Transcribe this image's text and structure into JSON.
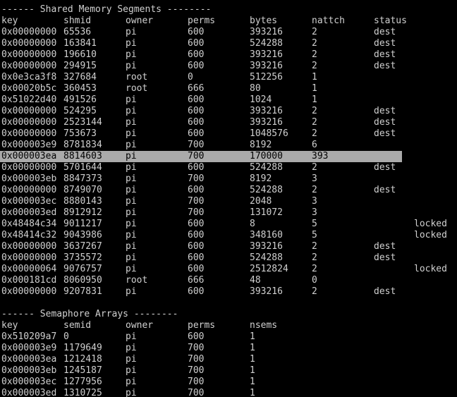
{
  "shm": {
    "title": "------ Shared Memory Segments --------",
    "headers": [
      "key",
      "shmid",
      "owner",
      "perms",
      "bytes",
      "nattch",
      "status"
    ],
    "rows": [
      [
        "0x00000000",
        "65536",
        "pi",
        "600",
        "393216",
        "2",
        "dest",
        ""
      ],
      [
        "0x00000000",
        "163841",
        "pi",
        "600",
        "524288",
        "2",
        "dest",
        ""
      ],
      [
        "0x00000000",
        "196610",
        "pi",
        "600",
        "393216",
        "2",
        "dest",
        ""
      ],
      [
        "0x00000000",
        "294915",
        "pi",
        "600",
        "393216",
        "2",
        "dest",
        ""
      ],
      [
        "0x0e3ca3f8",
        "327684",
        "root",
        "0",
        "512256",
        "1",
        "",
        ""
      ],
      [
        "0x00020b5c",
        "360453",
        "root",
        "666",
        "80",
        "1",
        "",
        ""
      ],
      [
        "0x51022d40",
        "491526",
        "pi",
        "600",
        "1024",
        "1",
        "",
        ""
      ],
      [
        "0x00000000",
        "524295",
        "pi",
        "600",
        "393216",
        "2",
        "dest",
        ""
      ],
      [
        "0x00000000",
        "2523144",
        "pi",
        "600",
        "393216",
        "2",
        "dest",
        ""
      ],
      [
        "0x00000000",
        "753673",
        "pi",
        "600",
        "1048576",
        "2",
        "dest",
        ""
      ],
      [
        "0x000003e9",
        "8781834",
        "pi",
        "700",
        "8192",
        "6",
        "",
        ""
      ],
      [
        "0x000003ea",
        "8814603",
        "pi",
        "700",
        "170000",
        "393",
        "",
        ""
      ],
      [
        "0x00000000",
        "5701644",
        "pi",
        "600",
        "524288",
        "2",
        "dest",
        ""
      ],
      [
        "0x000003eb",
        "8847373",
        "pi",
        "700",
        "8192",
        "3",
        "",
        ""
      ],
      [
        "0x00000000",
        "8749070",
        "pi",
        "600",
        "524288",
        "2",
        "dest",
        ""
      ],
      [
        "0x000003ec",
        "8880143",
        "pi",
        "700",
        "2048",
        "3",
        "",
        ""
      ],
      [
        "0x000003ed",
        "8912912",
        "pi",
        "700",
        "131072",
        "3",
        "",
        ""
      ],
      [
        "0x48484c34",
        "9011217",
        "pi",
        "600",
        "8",
        "5",
        "",
        "locked"
      ],
      [
        "0x48414c32",
        "9043986",
        "pi",
        "600",
        "348160",
        "5",
        "",
        "locked"
      ],
      [
        "0x00000000",
        "3637267",
        "pi",
        "600",
        "393216",
        "2",
        "dest",
        ""
      ],
      [
        "0x00000000",
        "3735572",
        "pi",
        "600",
        "524288",
        "2",
        "dest",
        ""
      ],
      [
        "0x00000064",
        "9076757",
        "pi",
        "600",
        "2512824",
        "2",
        "",
        "locked"
      ],
      [
        "0x000181cd",
        "8060950",
        "root",
        "666",
        "48",
        "0",
        "",
        ""
      ],
      [
        "0x00000000",
        "9207831",
        "pi",
        "600",
        "393216",
        "2",
        "dest",
        ""
      ]
    ],
    "highlight_index": 11
  },
  "sem": {
    "title": "------ Semaphore Arrays --------",
    "headers": [
      "key",
      "semid",
      "owner",
      "perms",
      "nsems"
    ],
    "rows": [
      [
        "0x510209a7",
        "0",
        "pi",
        "600",
        "1"
      ],
      [
        "0x000003e9",
        "1179649",
        "pi",
        "700",
        "1"
      ],
      [
        "0x000003ea",
        "1212418",
        "pi",
        "700",
        "1"
      ],
      [
        "0x000003eb",
        "1245187",
        "pi",
        "700",
        "1"
      ],
      [
        "0x000003ec",
        "1277956",
        "pi",
        "700",
        "1"
      ],
      [
        "0x000003ed",
        "1310725",
        "pi",
        "700",
        "1"
      ]
    ]
  },
  "colors": {
    "background": "#000000",
    "text": "#d0d0d0",
    "highlight_bg": "#aaaaaa",
    "highlight_fg": "#000000"
  }
}
